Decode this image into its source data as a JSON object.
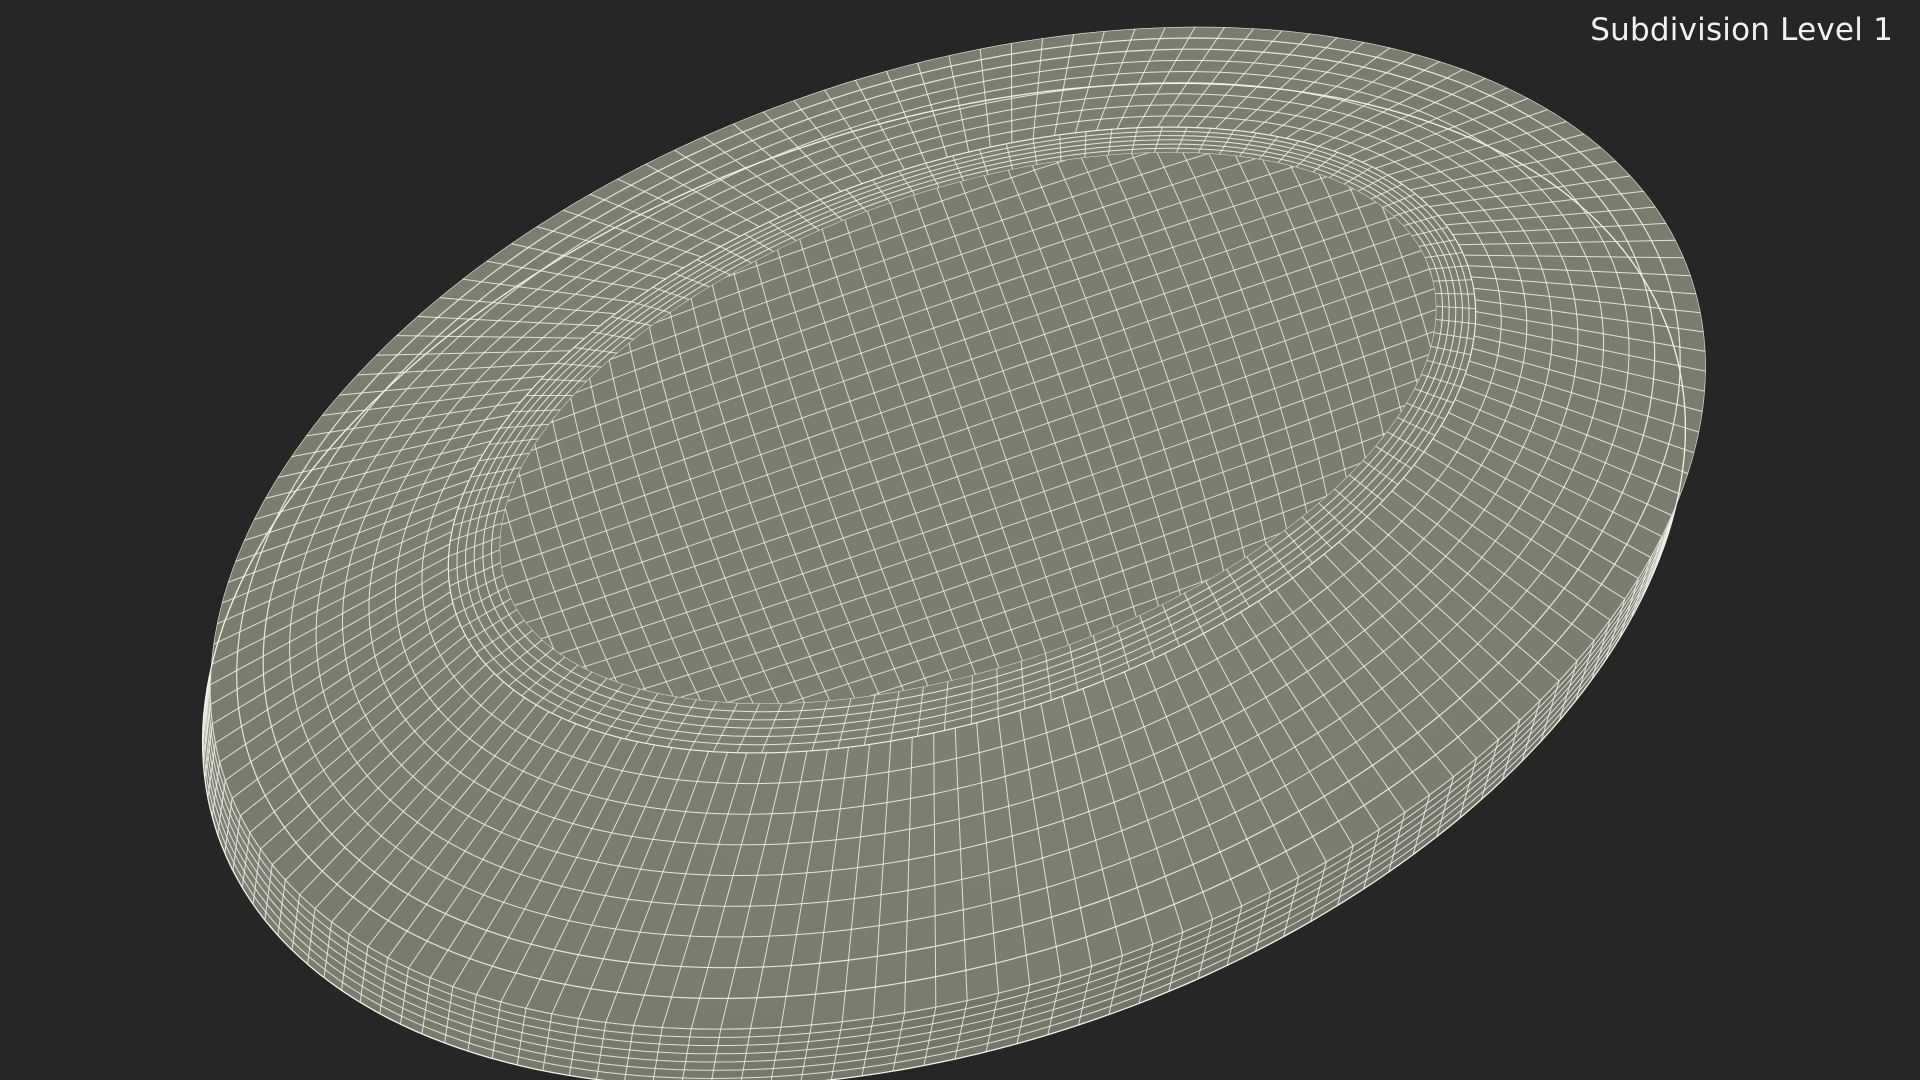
{
  "viewport": {
    "label": "Subdivision Level 1"
  },
  "colors": {
    "background": "#262626",
    "surface": "#7f7f72",
    "surface_dark": "#6f6f63",
    "wire": "#f2f2ea",
    "label": "#f2f2f2"
  },
  "model": {
    "kind": "oval-dish-wireframe",
    "display_mode": "wireframe-on-shaded"
  }
}
